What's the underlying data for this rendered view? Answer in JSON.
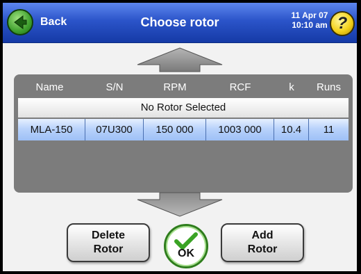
{
  "header": {
    "back_label": "Back",
    "title": "Choose rotor",
    "date": "11 Apr 07",
    "time": "10:10 am",
    "help_symbol": "?"
  },
  "rotor_table": {
    "columns": [
      "Name",
      "S/N",
      "RPM",
      "RCF",
      "k",
      "Runs"
    ],
    "no_rotor_label": "No Rotor Selected",
    "rows": [
      {
        "name": "MLA-150",
        "sn": "07U300",
        "rpm": "150 000",
        "rcf": "1003 000",
        "k": "10.4",
        "runs": "11",
        "selected": true
      }
    ]
  },
  "buttons": {
    "delete_rotor": "Delete\nRotor",
    "ok": "OK",
    "add_rotor": "Add\nRotor"
  },
  "icons": {
    "back": "back-arrow-icon",
    "help": "help-icon",
    "scroll_up": "scroll-up-arrow-icon",
    "scroll_down": "scroll-down-arrow-icon",
    "ok": "checkmark-icon"
  },
  "colors": {
    "header": "#2b54c9",
    "selection": "#9ec0f6",
    "panel": "#7c7c7c",
    "ok_green": "#2e7d1c"
  }
}
